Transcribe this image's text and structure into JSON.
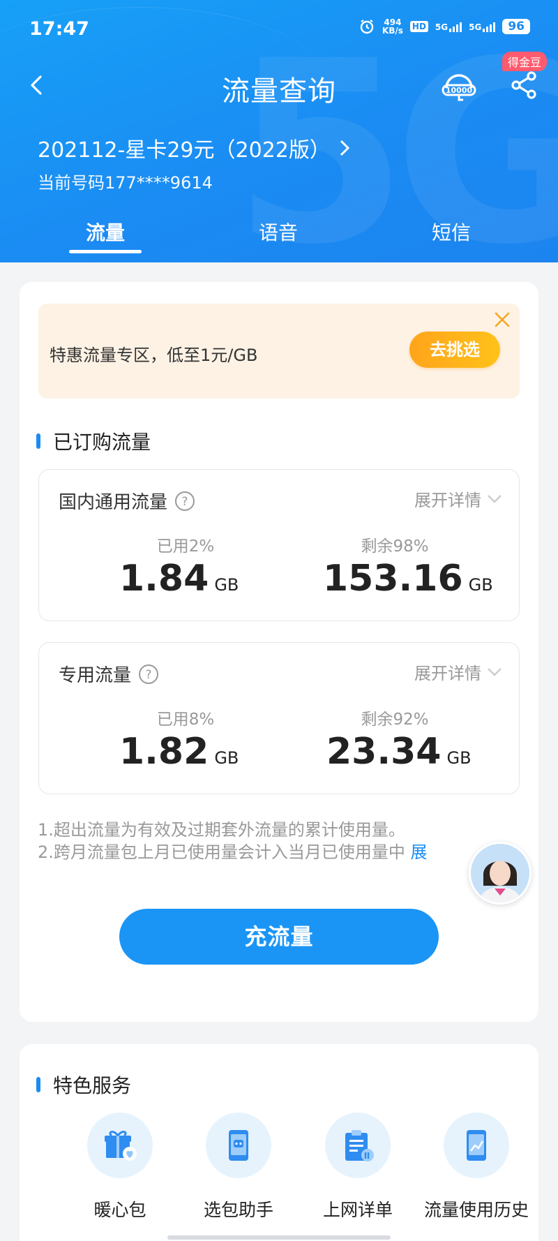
{
  "status_bar": {
    "time": "17:47",
    "net_speed_value": "494",
    "net_speed_unit": "KB/s",
    "hd_badge": "HD",
    "signal_1": "5G",
    "signal_2": "5G",
    "battery": "96"
  },
  "nav": {
    "title": "流量查询",
    "coin_badge": "得金豆"
  },
  "plan": {
    "name": "202112-星卡29元（2022版）",
    "phone": "当前号码177****9614"
  },
  "tabs": [
    {
      "label": "流量",
      "active": true
    },
    {
      "label": "语音",
      "active": false
    },
    {
      "label": "短信",
      "active": false
    }
  ],
  "promo": {
    "text": "特惠流量专区，低至1元/GB",
    "button": "去挑选"
  },
  "subscribed": {
    "title": "已订购流量",
    "boxes": [
      {
        "name": "国内通用流量",
        "expand": "展开详情",
        "used_label": "已用2%",
        "used_value": "1.84",
        "used_unit": "GB",
        "remain_label": "剩余98%",
        "remain_value": "153.16",
        "remain_unit": "GB"
      },
      {
        "name": "专用流量",
        "expand": "展开详情",
        "used_label": "已用8%",
        "used_value": "1.82",
        "used_unit": "GB",
        "remain_label": "剩余92%",
        "remain_value": "23.34",
        "remain_unit": "GB"
      }
    ]
  },
  "notes": [
    "1.超出流量为有效及过期套外流量的累计使用量。",
    "2.跨月流量包上月已使用量会计入当月已使用量中"
  ],
  "notes_more": "展",
  "charge_button": "充流量",
  "features": {
    "title": "特色服务",
    "items": [
      {
        "label": "暖心包",
        "icon": "gift-icon"
      },
      {
        "label": "选包助手",
        "icon": "phone-bot-icon"
      },
      {
        "label": "上网详单",
        "icon": "clipboard-icon"
      },
      {
        "label": "流量使用历史",
        "icon": "chart-phone-icon"
      }
    ]
  },
  "colors": {
    "primary": "#1a8cf3",
    "promo_bg": "#fdf2e4",
    "promo_button": "#ffa41b",
    "coin_badge": "#ff5a6e"
  }
}
